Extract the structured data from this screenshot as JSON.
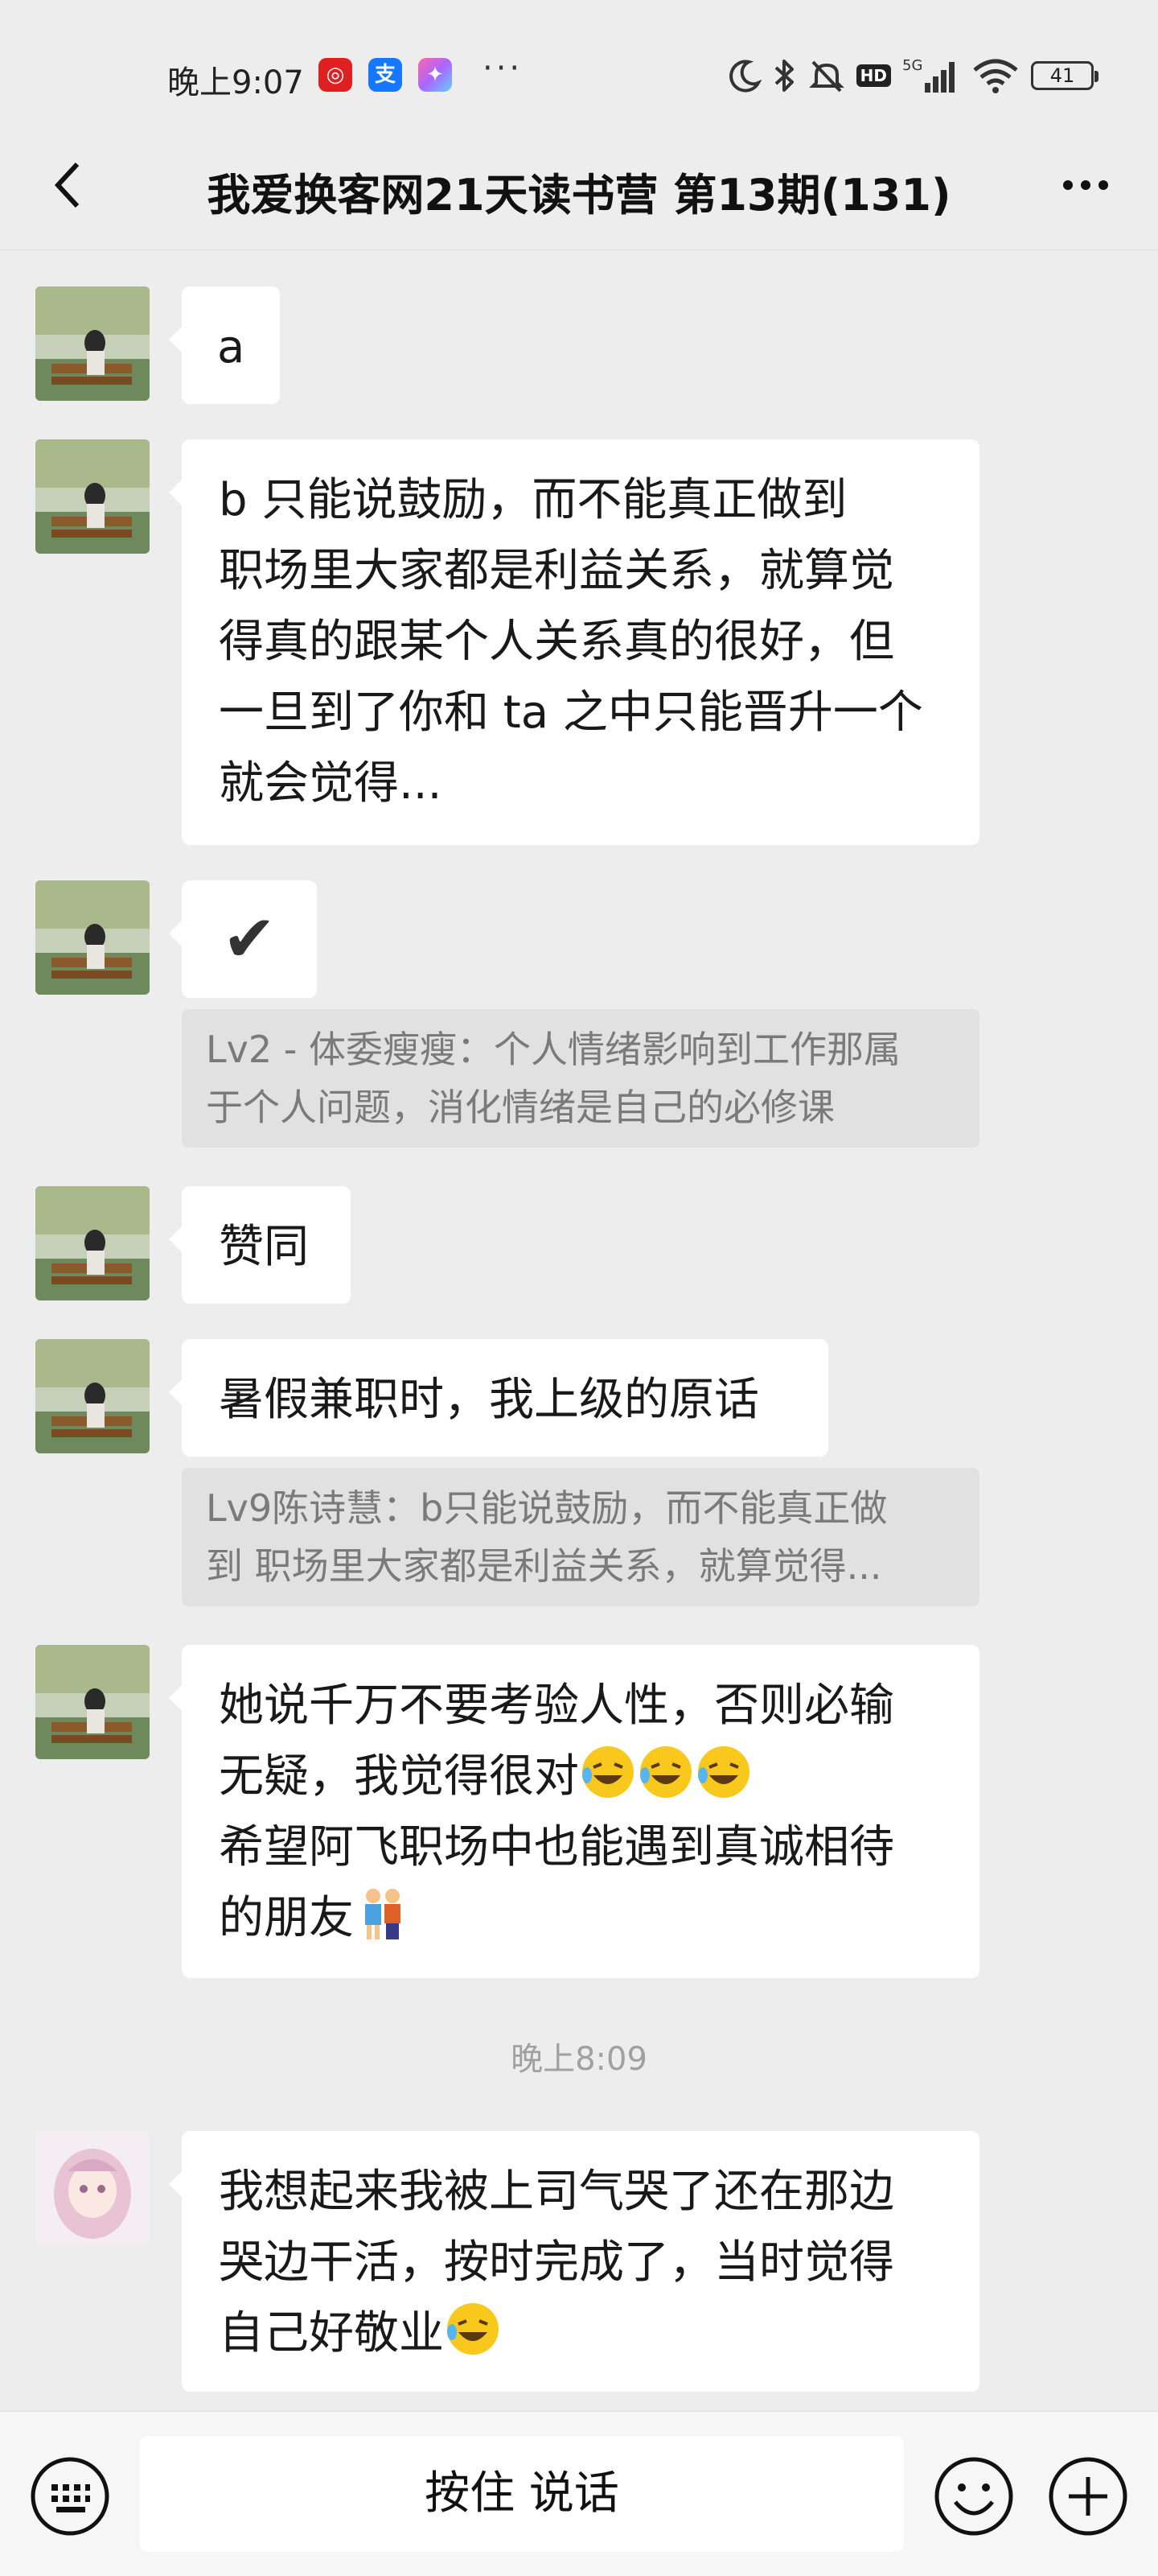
{
  "status_bar": {
    "time": "晚上9:07",
    "apps": [
      {
        "name": "netease-music-icon",
        "glyph": "◎",
        "color": "#e02020"
      },
      {
        "name": "alipay-icon",
        "glyph": "支",
        "color": "#1677ff"
      },
      {
        "name": "color-app-icon",
        "glyph": "✦",
        "color": "#e84cc0"
      }
    ],
    "more_dots": "···",
    "network": "5G",
    "hd": "HD",
    "battery": "41"
  },
  "header": {
    "title": "我爱换客网21天读书营 第13期(131)"
  },
  "messages": [
    {
      "text": "a"
    },
    {
      "text": "b 只能说鼓励，而不能真正做到\n职场里大家都是利益关系，就算觉\n得真的跟某个人关系真的很好，但\n一旦到了你和 ta 之中只能晋升一个\n就会觉得..."
    },
    {
      "text": "✔",
      "quote": "Lv2 - 体委瘦瘦：个人情绪影响到工作那属\n于个人问题，消化情绪是自己的必修课"
    },
    {
      "text": "赞同"
    },
    {
      "text": "暑假兼职时，我上级的原话",
      "quote": "Lv9陈诗慧：b只能说鼓励，而不能真正做\n到 职场里大家都是利益关系，就算觉得..."
    },
    {
      "text_before": "她说千万不要考验人性，否则必输\n无疑，我觉得很对",
      "text_after": "\n希望阿飞职场中也能遇到真诚相待\n的朋友"
    },
    {
      "text": "我想起来我被上司气哭了还在那边\n哭边干活，按时完成了，当时觉得\n自己好敬业"
    }
  ],
  "time_separator": "晚上8:09",
  "bottom_bar": {
    "voice_label": "按住 说话"
  }
}
